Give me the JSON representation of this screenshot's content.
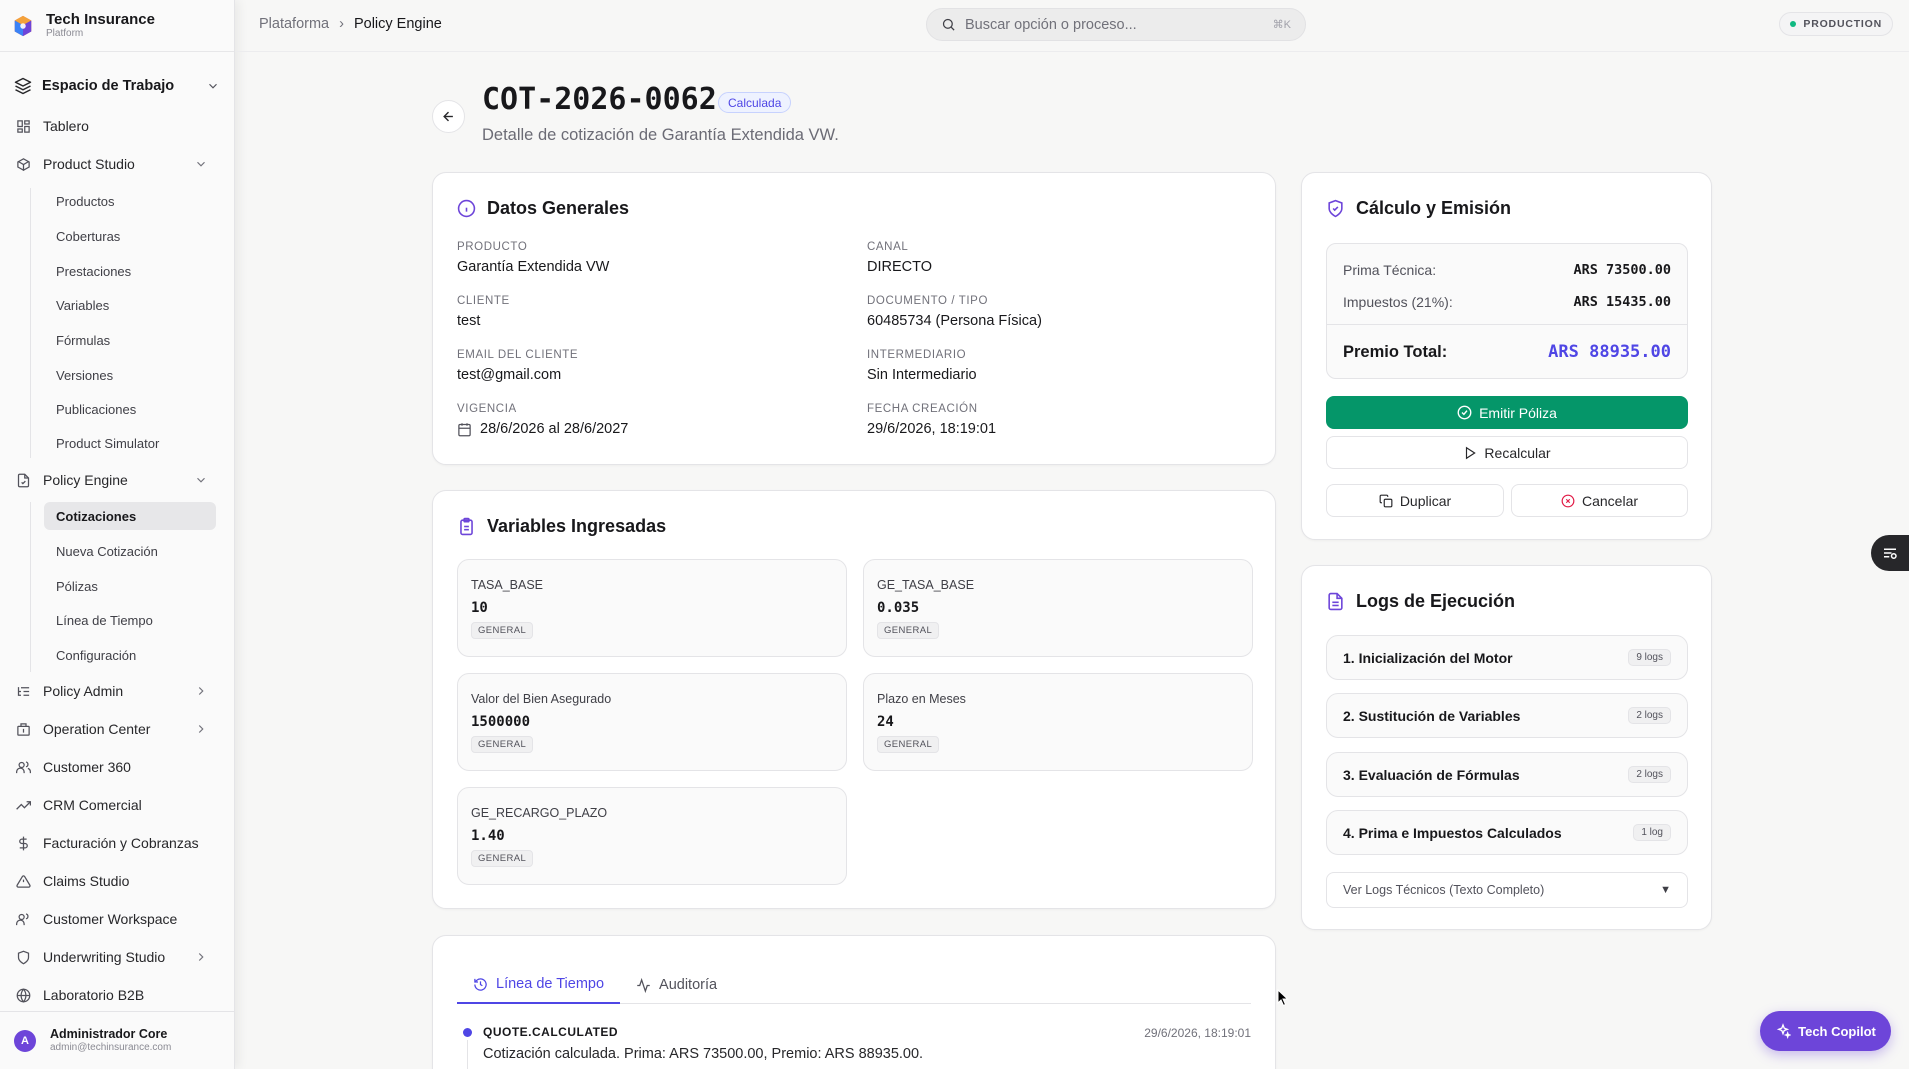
{
  "brand": {
    "title": "Tech Insurance",
    "subtitle": "Platform"
  },
  "workspace": {
    "label": "Espacio de Trabajo"
  },
  "sidebar": {
    "items": [
      {
        "label": "Tablero"
      },
      {
        "label": "Product Studio"
      },
      {
        "label": "Policy Engine"
      },
      {
        "label": "Policy Admin"
      },
      {
        "label": "Operation Center"
      },
      {
        "label": "Customer 360"
      },
      {
        "label": "CRM Comercial"
      },
      {
        "label": "Facturación y Cobranzas"
      },
      {
        "label": "Claims Studio"
      },
      {
        "label": "Customer Workspace"
      },
      {
        "label": "Underwriting Studio"
      },
      {
        "label": "Laboratorio B2B"
      }
    ],
    "product_studio_sub": [
      "Productos",
      "Coberturas",
      "Prestaciones",
      "Variables",
      "Fórmulas",
      "Versiones",
      "Publicaciones",
      "Product Simulator"
    ],
    "policy_engine_sub": [
      "Cotizaciones",
      "Nueva Cotización",
      "Pólizas",
      "Línea de Tiempo",
      "Configuración"
    ]
  },
  "user": {
    "initial": "A",
    "name": "Administrador Core",
    "email": "admin@techinsurance.com"
  },
  "topbar": {
    "breadcrumb_root": "Plataforma",
    "breadcrumb_current": "Policy Engine",
    "search_placeholder": "Buscar opción o proceso...",
    "search_shortcut": "⌘K",
    "env": "PRODUCTION"
  },
  "header": {
    "title": "COT-2026-0062",
    "status": "Calculada",
    "subtitle": "Detalle de cotización de Garantía Extendida VW."
  },
  "general": {
    "title": "Datos Generales",
    "fields": [
      {
        "label": "Producto",
        "value": "Garantía Extendida VW"
      },
      {
        "label": "Canal",
        "value": "DIRECTO"
      },
      {
        "label": "Cliente",
        "value": "test"
      },
      {
        "label": "Documento / Tipo",
        "value": "60485734 (Persona Física)"
      },
      {
        "label": "Email del Cliente",
        "value": "test@gmail.com"
      },
      {
        "label": "Intermediario",
        "value": "Sin Intermediario"
      },
      {
        "label": "Vigencia",
        "value": "28/6/2026 al 28/6/2027"
      },
      {
        "label": "Fecha Creación",
        "value": "29/6/2026, 18:19:01"
      }
    ]
  },
  "variables": {
    "title": "Variables Ingresadas",
    "items": [
      {
        "name": "TASA_BASE",
        "value": "10",
        "tag": "GENERAL"
      },
      {
        "name": "GE_TASA_BASE",
        "value": "0.035",
        "tag": "GENERAL"
      },
      {
        "name": "Valor del Bien Asegurado",
        "value": "1500000",
        "tag": "GENERAL"
      },
      {
        "name": "Plazo en Meses",
        "value": "24",
        "tag": "GENERAL"
      },
      {
        "name": "GE_RECARGO_PLAZO",
        "value": "1.40",
        "tag": "GENERAL"
      }
    ]
  },
  "timeline": {
    "tabs": [
      "Línea de Tiempo",
      "Auditoría"
    ],
    "event": {
      "type": "QUOTE.CALCULATED",
      "timestamp": "29/6/2026, 18:19:01",
      "description": "Cotización calculada. Prima: ARS 73500.00, Premio: ARS 88935.00."
    }
  },
  "calc": {
    "title": "Cálculo y Emisión",
    "prima_label": "Prima Técnica:",
    "prima_value": "ARS 73500.00",
    "tax_label": "Impuestos (21%):",
    "tax_value": "ARS 15435.00",
    "total_label": "Premio Total:",
    "total_value": "ARS 88935.00",
    "emit_label": "Emitir Póliza",
    "recalc_label": "Recalcular",
    "duplicate_label": "Duplicar",
    "cancel_label": "Cancelar"
  },
  "logs": {
    "title": "Logs de Ejecución",
    "items": [
      {
        "label": "1. Inicialización del Motor",
        "count": "9 logs"
      },
      {
        "label": "2. Sustitución de Variables",
        "count": "2 logs"
      },
      {
        "label": "3. Evaluación de Fórmulas",
        "count": "2 logs"
      },
      {
        "label": "4. Prima e Impuestos Calculados",
        "count": "1 log"
      }
    ],
    "more_label": "Ver Logs Técnicos (Texto Completo)",
    "more_arrow": "▼"
  },
  "copilot": {
    "label": "Tech Copilot"
  },
  "colors": {
    "accent": "#4f46e5",
    "brand": "#6d45d9",
    "success": "#059669"
  }
}
